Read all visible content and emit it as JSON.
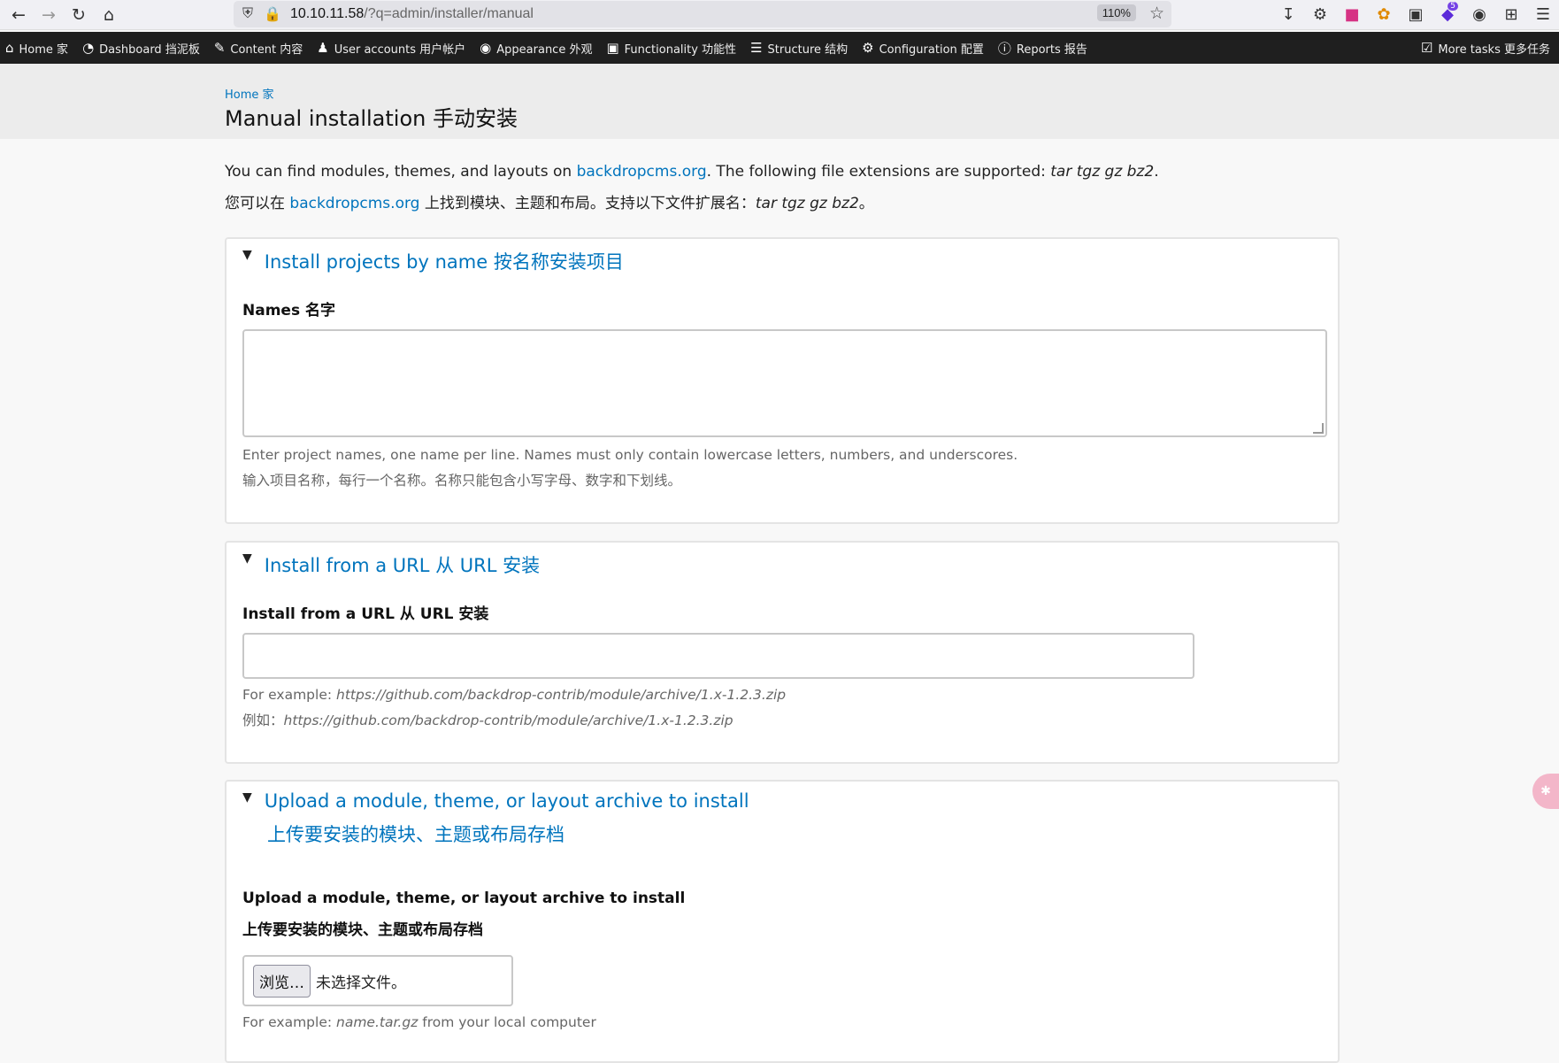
{
  "browser": {
    "url_host": "10.10.11.58",
    "url_path": "/?q=admin/installer/manual",
    "zoom": "110%",
    "extension_badge": "5"
  },
  "admin_bar": {
    "items": [
      {
        "label": "Home 家",
        "icon": "home-icon"
      },
      {
        "label": "Dashboard 挡泥板",
        "icon": "dashboard-icon"
      },
      {
        "label": "Content 内容",
        "icon": "pencil-icon"
      },
      {
        "label": "User accounts 用户帐户",
        "icon": "users-icon"
      },
      {
        "label": "Appearance 外观",
        "icon": "palette-icon"
      },
      {
        "label": "Functionality 功能性",
        "icon": "puzzle-icon"
      },
      {
        "label": "Structure 结构",
        "icon": "layers-icon"
      },
      {
        "label": "Configuration 配置",
        "icon": "gear-icon"
      },
      {
        "label": "Reports 报告",
        "icon": "info-icon"
      }
    ],
    "more_tasks": "More tasks 更多任务"
  },
  "header": {
    "breadcrumb": "Home 家",
    "title": "Manual installation  手动安装"
  },
  "intro": {
    "en_prefix": "You can find modules, themes, and layouts on ",
    "link": "backdropcms.org",
    "en_middle": ". The following file extensions are supported: ",
    "extensions": "tar tgz gz bz2",
    "en_suffix": ".",
    "zh_prefix": "您可以在 ",
    "zh_middle": " 上找到模块、主题和布局。支持以下文件扩展名：",
    "zh_suffix": "。"
  },
  "section_names": {
    "legend": "Install projects by name  按名称安装项目",
    "label": "Names   名字",
    "desc_en": "Enter project names, one name per line. Names must only contain lowercase letters, numbers, and underscores.",
    "desc_zh": "输入项目名称，每行一个名称。名称只能包含小写字母、数字和下划线。"
  },
  "section_url": {
    "legend": "Install from a URL  从 URL 安装",
    "label": "Install from a URL   从 URL 安装",
    "example_prefix_en": "For example: ",
    "example_url": "https://github.com/backdrop-contrib/module/archive/1.x-1.2.3.zip",
    "example_prefix_zh": "例如："
  },
  "section_upload": {
    "legend_en": "Upload a module, theme, or layout archive to install",
    "legend_zh": "上传要安装的模块、主题或布局存档",
    "label_en": "Upload a module, theme, or layout archive to install",
    "label_zh": "上传要安装的模块、主题或布局存档",
    "browse": "浏览…",
    "no_file": "未选择文件。",
    "example_prefix": "For example: ",
    "example_file": "name.tar.gz",
    "example_suffix": " from your local computer"
  }
}
